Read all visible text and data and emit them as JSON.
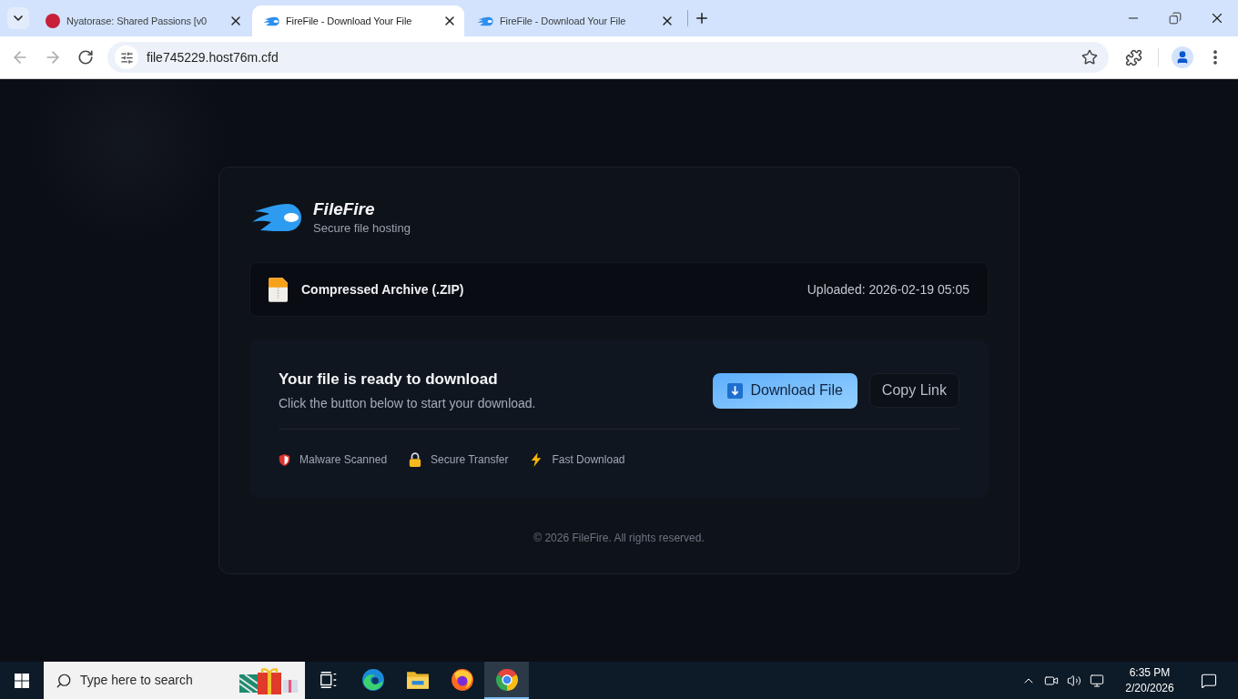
{
  "browser": {
    "tabs": [
      {
        "title": "Nyatorase: Shared Passions [v0",
        "kind": "avatar",
        "selected": false
      },
      {
        "title": "FireFile - Download Your File",
        "kind": "flame",
        "selected": true
      },
      {
        "title": "FireFile - Download Your File",
        "kind": "flame",
        "selected": false
      }
    ],
    "address": "file745229.host76m.cfd"
  },
  "page": {
    "brand": {
      "name": "FileFire",
      "tagline": "Secure file hosting"
    },
    "file": {
      "type_label": "Compressed Archive (.ZIP)",
      "uploaded": "Uploaded: 2026-02-19 05:05"
    },
    "download": {
      "title": "Your file is ready to download",
      "subtitle": "Click the button below to start your download.",
      "buttons": [
        {
          "label": "Download File",
          "kind": "primary"
        },
        {
          "label": "Copy Link",
          "kind": "secondary"
        }
      ],
      "features": [
        {
          "label": "Malware Scanned",
          "kind": "shield"
        },
        {
          "label": "Secure Transfer",
          "kind": "lock"
        },
        {
          "label": "Fast Download",
          "kind": "bolt"
        }
      ]
    },
    "footer": "© 2026 FileFire. All rights reserved."
  },
  "taskbar": {
    "search": {
      "placeholder": "Type here to search"
    },
    "apps": [
      {
        "kind": "task-view",
        "selected": false
      },
      {
        "kind": "edge",
        "selected": false
      },
      {
        "kind": "explorer",
        "selected": false
      },
      {
        "kind": "firefox",
        "selected": false
      },
      {
        "kind": "chrome",
        "selected": true
      }
    ],
    "clock": {
      "time": "6:35 PM",
      "date": "2/20/2026"
    }
  }
}
